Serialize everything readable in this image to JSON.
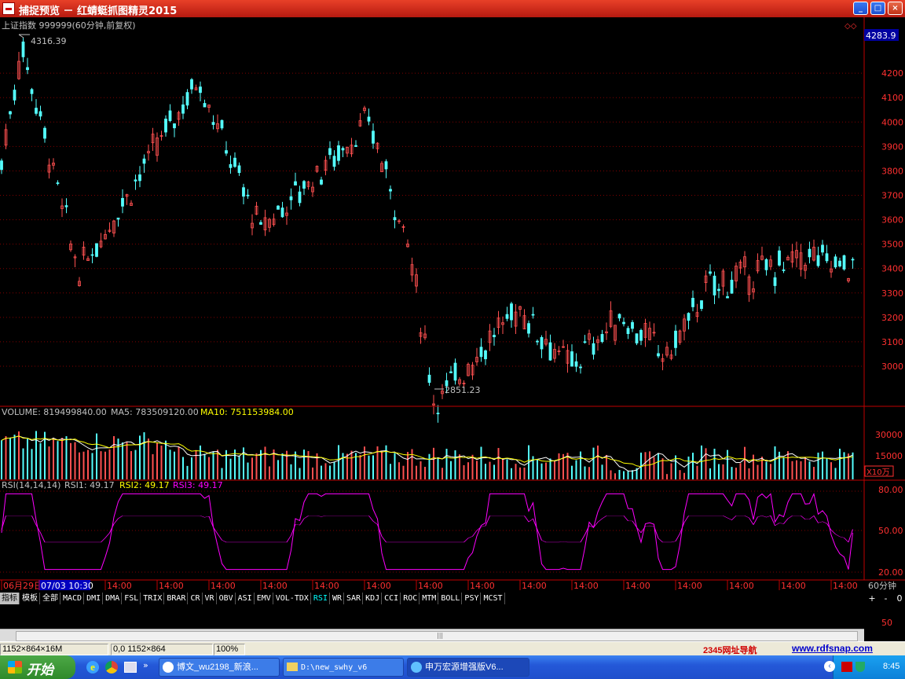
{
  "window": {
    "title": "捕捉预览 － 红蜻蜓抓图精灵2015"
  },
  "chart": {
    "header": "上证指数 999999(60分钟,前复权)",
    "price_axis_top": "4283.9",
    "price_ticks": [
      "4200",
      "4100",
      "4000",
      "3900",
      "3800",
      "3700",
      "3600",
      "3500",
      "3400",
      "3300",
      "3200",
      "3100",
      "3000"
    ],
    "high_label": "4316.39",
    "low_label": "2851.23",
    "volume_header": {
      "label": "VOLUME: 819499840.00",
      "ma5": "MA5: 783509120.00",
      "ma10": "MA10: 751153984.00"
    },
    "volume_ticks": [
      "30000",
      "15000"
    ],
    "volume_unit": "X10万",
    "rsi_header": {
      "label": "RSI(14,14,14)",
      "rsi1": "RSI1: 49.17",
      "rsi2": "RSI2: 49.17",
      "rsi3": "RSI3: 49.17"
    },
    "rsi_ticks": [
      "80.00",
      "50.00",
      "20.00"
    ],
    "time_labels": [
      "06月29日",
      "07/03 10:30",
      "14:00",
      "14:00",
      "14:00",
      "14:00",
      "14:00",
      "14:00",
      "14:00",
      "14:00",
      "14:00",
      "14:00",
      "14:00",
      "14:00",
      "14:00",
      "14:00",
      "14:00",
      "14:00"
    ],
    "period": "60分钟",
    "colors": {
      "up": "#ff5050",
      "down": "#54ffff",
      "ma5": "#ffffff",
      "ma10": "#ffff00",
      "rsi": "#ff00ff",
      "grid": "#800000"
    }
  },
  "tabs": [
    "指标",
    "模板",
    "全部",
    "MACD",
    "DMI",
    "DMA",
    "FSL",
    "TRIX",
    "BRAR",
    "CR",
    "VR",
    "OBV",
    "ASI",
    "EMV",
    "VOL-TDX",
    "RSI",
    "WR",
    "SAR",
    "KDJ",
    "CCI",
    "ROC",
    "MTM",
    "BOLL",
    "PSY",
    "MCST"
  ],
  "tab_controls": [
    "+",
    "-",
    "0"
  ],
  "mini_rsi_tick": "50",
  "status": {
    "dims": "1152×864×16M",
    "pos": "0,0  1152×864",
    "zoom": "100%",
    "nav": "2345网址导航",
    "url": "www.rdfsnap.com"
  },
  "taskbar": {
    "start": "开始",
    "tasks": [
      "博文_wu2198_新浪...",
      "D:\\new_swhy_v6",
      "申万宏源增强版V6..."
    ],
    "clock": "8:45"
  },
  "chart_data": {
    "type": "candlestick",
    "title": "上证指数 999999(60分钟,前复权)",
    "y_range": [
      2851.23,
      4316.39
    ],
    "annotated_high": 4316.39,
    "annotated_low": 2851.23,
    "last_price_axis": 4283.9,
    "anchors_close": [
      {
        "t": "06月29日",
        "v": 3800
      },
      {
        "t": "start",
        "v": 4316.39
      },
      {
        "t": "trough1",
        "v": 3380
      },
      {
        "t": "peak2",
        "v": 4180
      },
      {
        "t": "trough2",
        "v": 3560
      },
      {
        "t": "peak3",
        "v": 4000
      },
      {
        "t": "drop",
        "v": 3500
      },
      {
        "t": "07/03 low",
        "v": 2851.23
      },
      {
        "t": "rebound",
        "v": 3240
      },
      {
        "t": "dip",
        "v": 3000
      },
      {
        "t": "mid",
        "v": 3200
      },
      {
        "t": "low3",
        "v": 3040
      },
      {
        "t": "rise",
        "v": 3320
      },
      {
        "t": "high4",
        "v": 3450
      },
      {
        "t": "last",
        "v": 3400
      }
    ],
    "volume_scale_ticks": [
      15000,
      30000
    ],
    "rsi_ticks": [
      20,
      50,
      80
    ],
    "rsi_last": 49.17
  }
}
